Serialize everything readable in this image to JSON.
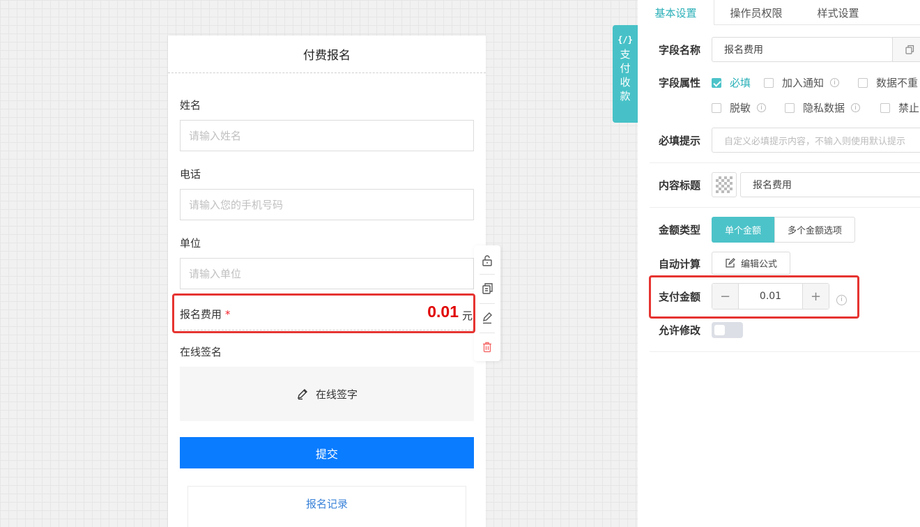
{
  "form": {
    "title": "付费报名",
    "fields": [
      {
        "label": "姓名",
        "placeholder": "请输入姓名"
      },
      {
        "label": "电话",
        "placeholder": "请输入您的手机号码"
      },
      {
        "label": "单位",
        "placeholder": "请输入单位"
      }
    ],
    "fee": {
      "label": "报名费用",
      "required_mark": "*",
      "amount": "0.01",
      "unit": "元"
    },
    "signature": {
      "label": "在线签名",
      "button": "在线签字"
    },
    "submit": "提交",
    "records": "报名记录"
  },
  "toolbar": {
    "icons": [
      "unlock-icon",
      "copy-icon",
      "edit-icon",
      "trash-icon"
    ],
    "danger_color": "#f56c6c"
  },
  "side_tab": {
    "code": "{/}",
    "label": "支付收款"
  },
  "panel": {
    "tabs": [
      "基本设置",
      "操作员权限",
      "样式设置"
    ],
    "field_name": {
      "label": "字段名称",
      "value": "报名费用"
    },
    "field_attr": {
      "label": "字段属性",
      "options": [
        {
          "text": "必填",
          "checked": true
        },
        {
          "text": "加入通知",
          "checked": false
        },
        {
          "text": "数据不重",
          "checked": false
        },
        {
          "text": "脱敏",
          "checked": false
        },
        {
          "text": "隐私数据",
          "checked": false
        },
        {
          "text": "禁止",
          "checked": false
        }
      ]
    },
    "required_tip": {
      "label": "必填提示",
      "placeholder": "自定义必填提示内容，不输入则使用默认提示"
    },
    "content_title": {
      "label": "内容标题",
      "value": "报名费用"
    },
    "amount_type": {
      "label": "金额类型",
      "options": [
        "单个金额",
        "多个金额选项"
      ]
    },
    "auto_calc": {
      "label": "自动计算",
      "button": "编辑公式"
    },
    "pay_amount": {
      "label": "支付金额",
      "value": "0.01",
      "minus": "−",
      "plus": "+"
    },
    "allow_edit": {
      "label": "允许修改",
      "on": false
    }
  },
  "colors": {
    "accent": "#4cc3c9",
    "primary": "#0a7cff",
    "highlight": "#e63431",
    "fee_amount": "#e10000"
  }
}
